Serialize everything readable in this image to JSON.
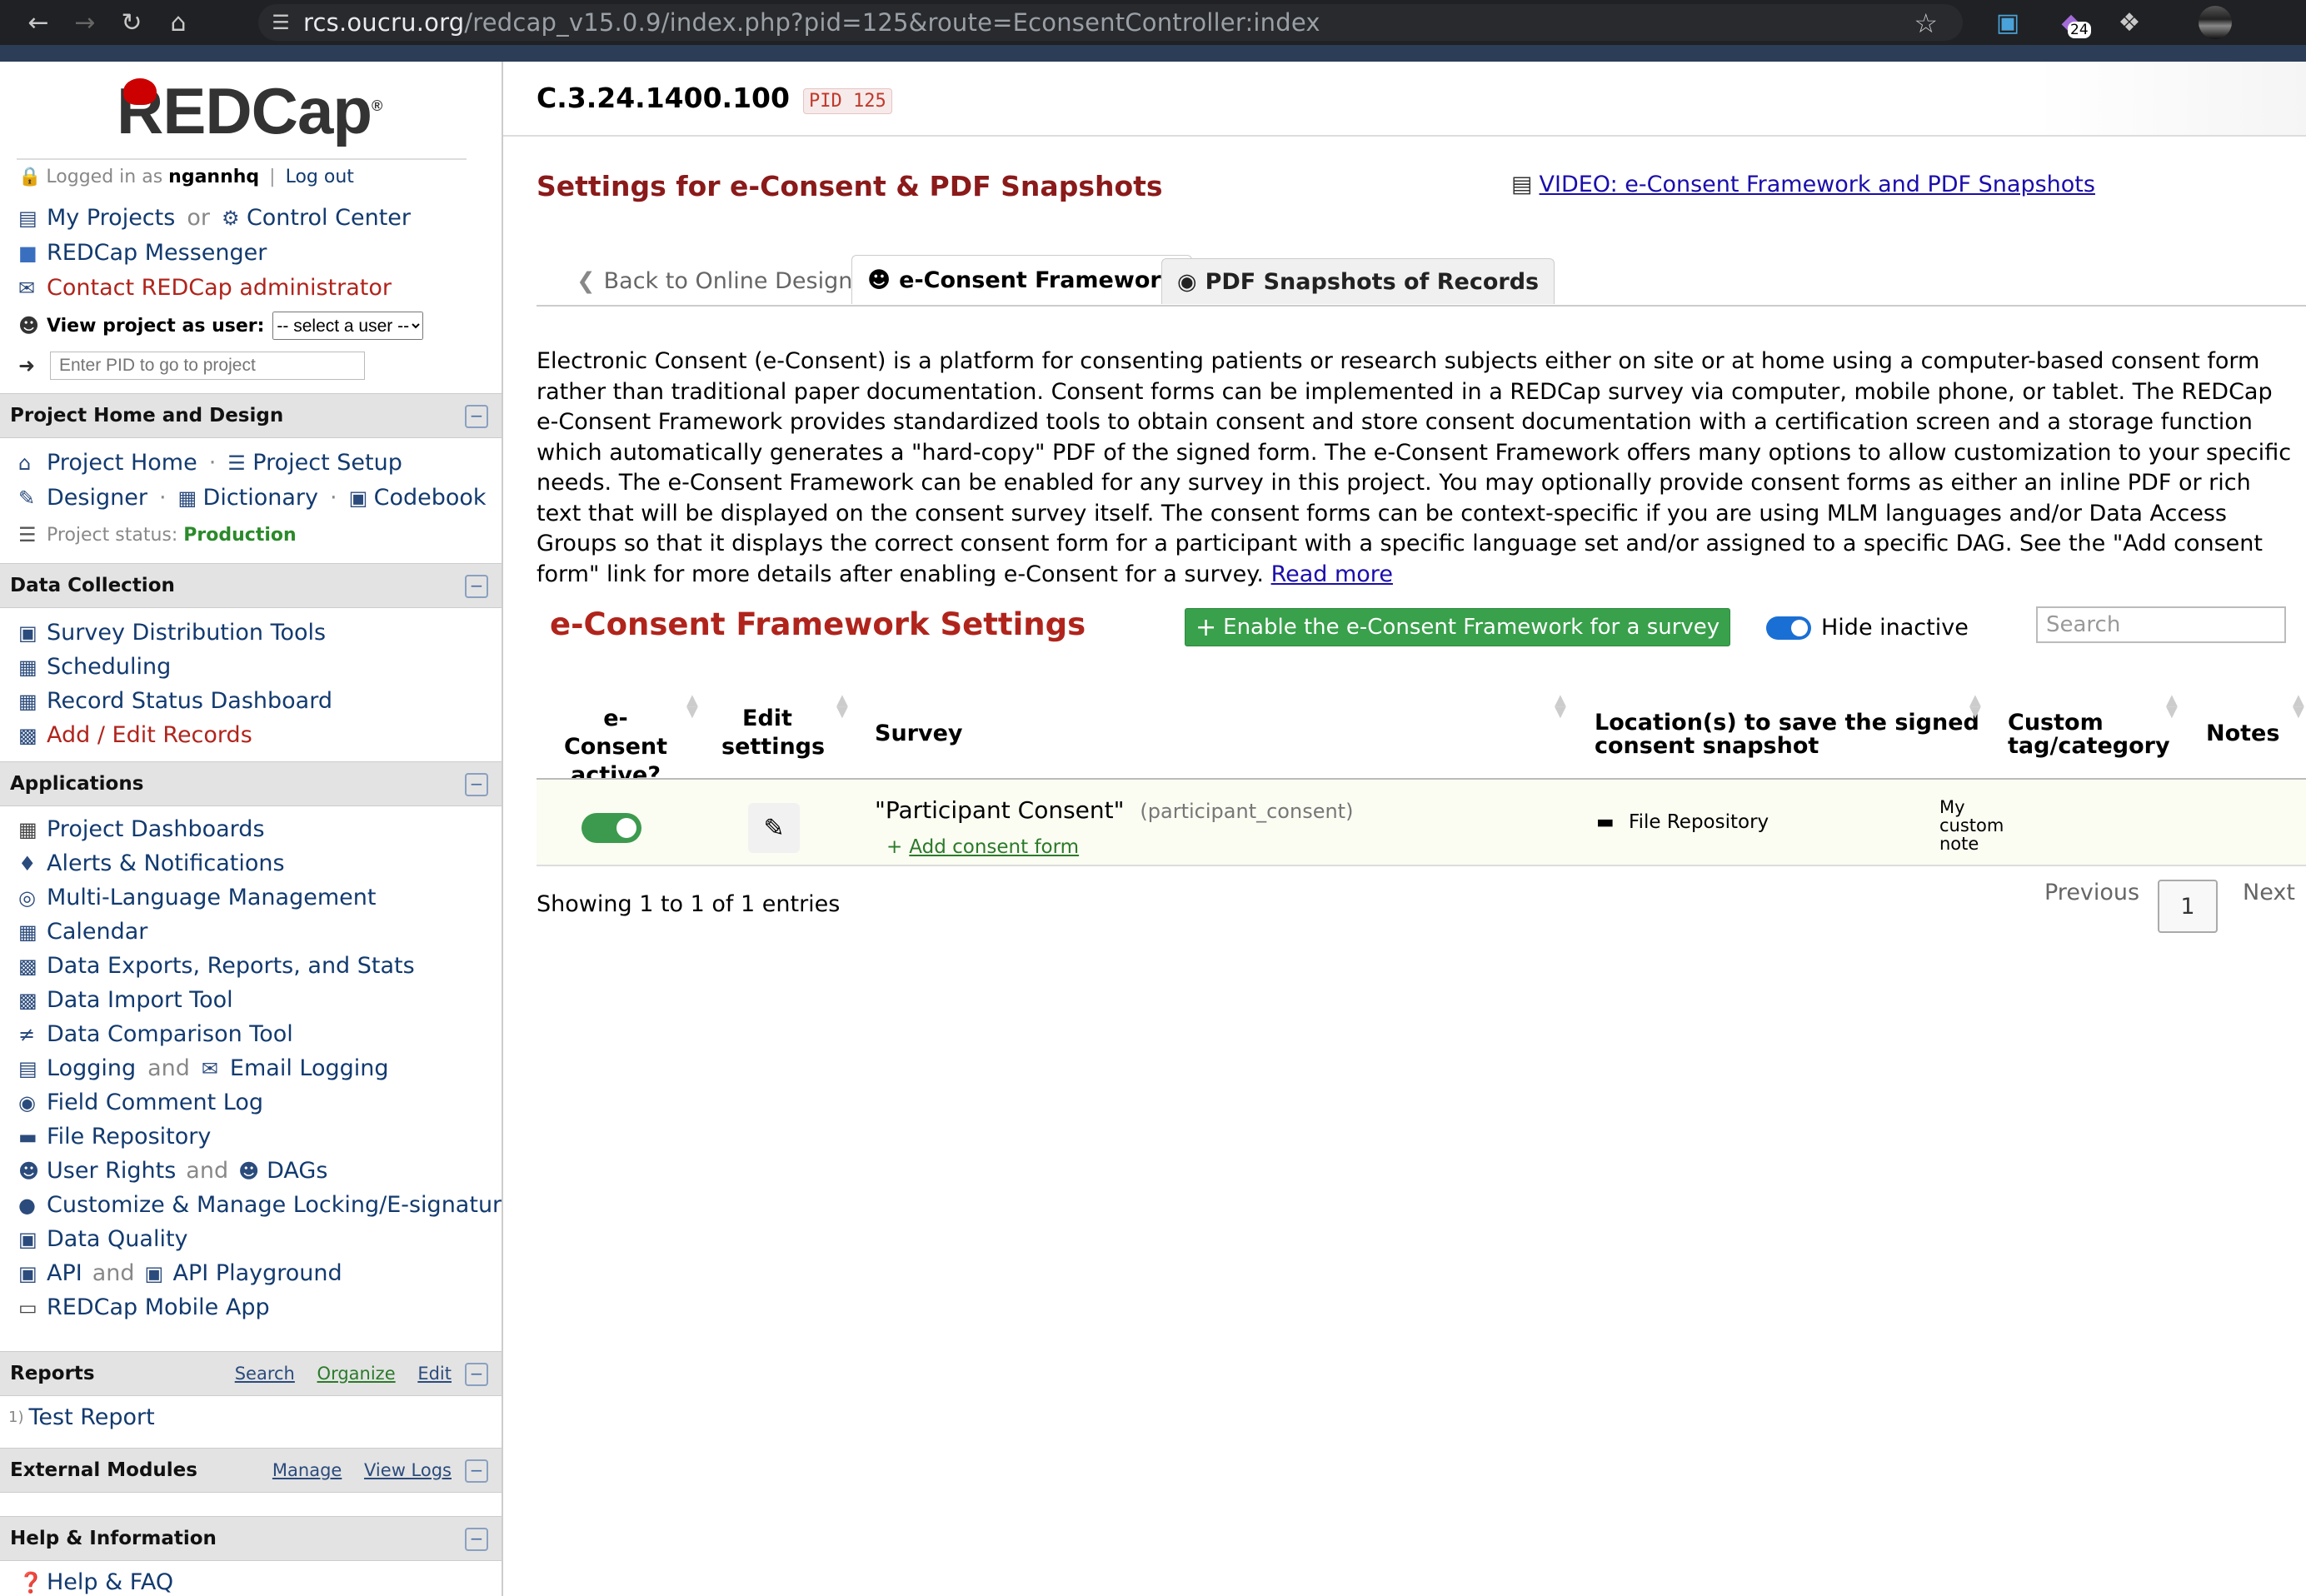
{
  "browser": {
    "url_host": "rcs.oucru.org",
    "url_path": "/redcap_v15.0.9/index.php?pid=125&route=EconsentController:index",
    "badge": "24"
  },
  "sidebar": {
    "logo": "REDCap",
    "logged_in_prefix": "Logged in as",
    "username": "ngannhq",
    "logout": "Log out",
    "my_projects": "My Projects",
    "or": "or",
    "control_center": "Control Center",
    "messenger": "REDCap Messenger",
    "contact_admin": "Contact REDCap administrator",
    "view_as_label": "View project as user:",
    "view_as_value": "-- select a user --",
    "pid_placeholder": "Enter PID to go to project",
    "sections": {
      "home": "Project Home and Design",
      "collection": "Data Collection",
      "apps": "Applications",
      "reports": "Reports",
      "modules": "External Modules",
      "help": "Help & Information"
    },
    "home": {
      "project_home": "Project Home",
      "project_setup": "Project Setup",
      "designer": "Designer",
      "dictionary": "Dictionary",
      "codebook": "Codebook",
      "status_label": "Project status:",
      "status_value": "Production"
    },
    "collection": [
      "Survey Distribution Tools",
      "Scheduling",
      "Record Status Dashboard",
      "Add / Edit Records"
    ],
    "apps": {
      "project_dashboards": "Project Dashboards",
      "alerts": "Alerts & Notifications",
      "mlm": "Multi-Language Management",
      "calendar": "Calendar",
      "exports": "Data Exports, Reports, and Stats",
      "import": "Data Import Tool",
      "comparison": "Data Comparison Tool",
      "logging": "Logging",
      "and": "and",
      "email_logging": "Email Logging",
      "field_comment": "Field Comment Log",
      "file_repo": "File Repository",
      "user_rights": "User Rights",
      "dags": "DAGs",
      "locking": "Customize & Manage Locking/E-signatures",
      "data_quality": "Data Quality",
      "api": "API",
      "api_playground": "API Playground",
      "mobile_app": "REDCap Mobile App"
    },
    "reports_tools": [
      "Search",
      "Organize",
      "Edit"
    ],
    "report_num": "1)",
    "report_item": "Test Report",
    "modules_tools": [
      "Manage",
      "View Logs"
    ],
    "help_item": "Help & FAQ"
  },
  "main": {
    "project_name": "C.3.24.1400.100",
    "pid_badge": "PID 125",
    "page_title": "Settings for e-Consent & PDF Snapshots",
    "video_link": "VIDEO: e-Consent Framework and PDF Snapshots",
    "tabs": {
      "back": "Back to Online Designer",
      "framework": "e-Consent Framework",
      "snapshots": "PDF Snapshots of Records"
    },
    "description": "Electronic Consent (e-Consent) is a platform for consenting patients or research subjects either on site or at home using a computer-based consent form rather than traditional paper documentation. Consent forms can be implemented in a REDCap survey via computer, mobile phone, or tablet. The REDCap e-Consent Framework provides standardized tools to obtain consent and store consent documentation with a certification screen and a storage function which automatically generates a \"hard-copy\" PDF of the signed form. The e-Consent Framework offers many options to allow customization to your specific needs. The e-Consent Framework can be enabled for any survey in this project. You may optionally provide consent forms as either an inline PDF or rich text that will be displayed on the consent survey itself. The consent forms can be context-specific if you are using MLM languages and/or Data Access Groups so that it displays the correct consent form for a participant with a specific language set and/or assigned to a specific DAG. See the \"Add consent form\" link for more details after enabling e-Consent for a survey.",
    "read_more": "Read more",
    "settings_title": "e-Consent Framework Settings",
    "enable_button": "Enable the e-Consent Framework for a survey",
    "hide_inactive": "Hide inactive",
    "search_placeholder": "Search",
    "table": {
      "headers": {
        "active_1": "e-Consent",
        "active_2": "active?",
        "edit_1": "Edit",
        "edit_2": "settings",
        "survey": "Survey",
        "loc_1": "Location(s) to save the signed",
        "loc_2": "consent snapshot",
        "tag_1": "Custom",
        "tag_2": "tag/category",
        "notes": "Notes"
      },
      "rows": [
        {
          "active": true,
          "survey_title": "\"Participant Consent\"",
          "survey_var": "(participant_consent)",
          "add_form": "Add consent form",
          "location": "File Repository",
          "note_1": "My",
          "note_2": "custom",
          "note_3": "note"
        }
      ]
    },
    "showing": "Showing 1 to 1 of 1 entries",
    "pager": {
      "prev": "Previous",
      "page": "1",
      "next": "Next"
    }
  },
  "colors": {
    "title_red": "#b0241c",
    "green_button": "#39a04b",
    "toggle_blue": "#1a6fd4",
    "toggle_green": "#3c9a4e"
  }
}
